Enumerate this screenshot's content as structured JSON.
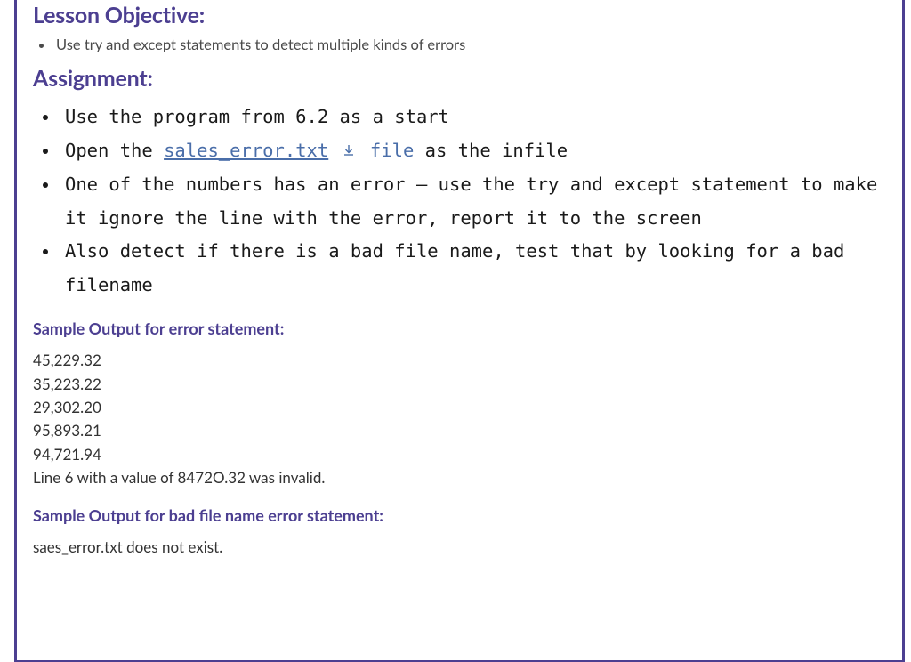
{
  "headings": {
    "objective": "Lesson Objective:",
    "assignment": "Assignment:",
    "sample_error": "Sample Output for error statement:",
    "sample_badfile": "Sample Output for bad file name error statement:"
  },
  "objective_items": [
    "Use try and except statements to detect multiple kinds of errors"
  ],
  "assignment_items": {
    "item1": "Use the program from 6.2 as a start",
    "item2_pre": "Open the ",
    "item2_link": "sales_error.txt",
    "item2_file_word": "file",
    "item2_post": " as the infile",
    "item3": "One of the numbers has an error – use the try and except statement to make it ignore the line with the error, report it to the screen",
    "item4": "Also detect if there is a bad file name, test that by looking for a bad filename"
  },
  "sample_error_lines": [
    "45,229.32",
    "35,223.22",
    "29,302.20",
    "95,893.21",
    "94,721.94",
    "Line 6 with a value of 8472O.32 was invalid."
  ],
  "sample_badfile_lines": [
    "saes_error.txt does not exist."
  ]
}
